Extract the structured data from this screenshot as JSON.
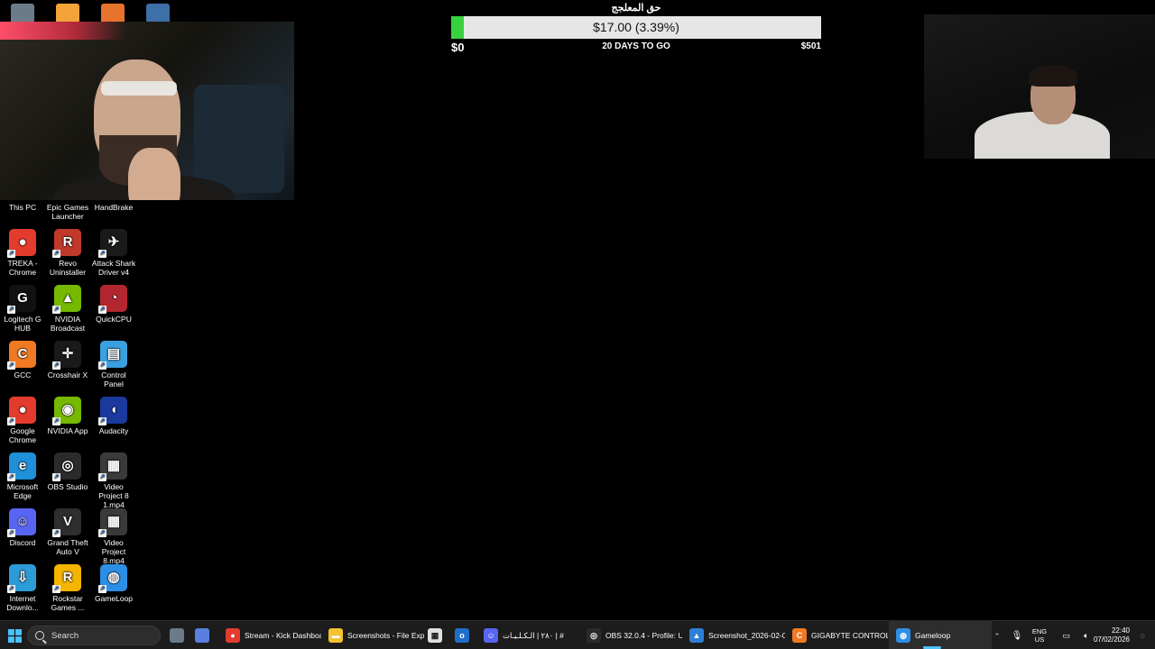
{
  "goal": {
    "title": "حق المعلجج",
    "amount_label": "$17.00 (3.39%)",
    "progress_percent": 3.39,
    "min_label": "$0",
    "days_label": "20 DAYS TO GO",
    "max_label": "$501",
    "fill_color": "#39d23f"
  },
  "desktop_icons": [
    {
      "label": "This PC",
      "icon": "this-pc-icon",
      "color": "#3d8ee8",
      "glyph": ""
    },
    {
      "label": "Epic Games Launcher",
      "icon": "epic-games-icon",
      "color": "#2a2a2a",
      "glyph": "E"
    },
    {
      "label": "HandBrake",
      "icon": "handbrake-icon",
      "color": "#e8732c",
      "glyph": "H"
    },
    {
      "label": "TREKA - Chrome",
      "icon": "chrome-icon",
      "color": "#e33b2e",
      "glyph": "●"
    },
    {
      "label": "Revo Uninstaller",
      "icon": "revo-uninstaller-icon",
      "color": "#c0392b",
      "glyph": "R"
    },
    {
      "label": "Attack Shark Driver v4",
      "icon": "attack-shark-icon",
      "color": "#1a1a1a",
      "glyph": "✈"
    },
    {
      "label": "Logitech G HUB",
      "icon": "logitech-ghub-icon",
      "color": "#111111",
      "glyph": "G"
    },
    {
      "label": "NVIDIA Broadcast",
      "icon": "nvidia-broadcast-icon",
      "color": "#76b900",
      "glyph": "▲"
    },
    {
      "label": "QuickCPU",
      "icon": "quickcpu-icon",
      "color": "#b3262f",
      "glyph": "◔"
    },
    {
      "label": "GCC",
      "icon": "gcc-icon",
      "color": "#f07a24",
      "glyph": "C"
    },
    {
      "label": "Crosshair X",
      "icon": "crosshair-icon",
      "color": "#1a1a1a",
      "glyph": "✛"
    },
    {
      "label": "Control Panel",
      "icon": "control-panel-icon",
      "color": "#3aa0e0",
      "glyph": "▤"
    },
    {
      "label": "Google Chrome",
      "icon": "chrome-icon",
      "color": "#e33b2e",
      "glyph": "●"
    },
    {
      "label": "NVIDIA App",
      "icon": "nvidia-app-icon",
      "color": "#76b900",
      "glyph": "◉"
    },
    {
      "label": "Audacity",
      "icon": "audacity-icon",
      "color": "#1b3a9e",
      "glyph": "◖"
    },
    {
      "label": "Microsoft Edge",
      "icon": "edge-icon",
      "color": "#1f8fd8",
      "glyph": "e"
    },
    {
      "label": "OBS Studio",
      "icon": "obs-icon",
      "color": "#2b2b2b",
      "glyph": "◎"
    },
    {
      "label": "Video Project 8 1.mp4",
      "icon": "video-file-icon",
      "color": "#3a3a3a",
      "glyph": "▦"
    },
    {
      "label": "Discord",
      "icon": "discord-icon",
      "color": "#5865f2",
      "glyph": "☺"
    },
    {
      "label": "Grand Theft Auto V",
      "icon": "gta-icon",
      "color": "#2e2e2e",
      "glyph": "V"
    },
    {
      "label": "Video Project 8.mp4",
      "icon": "video-file-icon",
      "color": "#3a3a3a",
      "glyph": "▦"
    },
    {
      "label": "Internet Downlo...",
      "icon": "idm-icon",
      "color": "#2d9bd6",
      "glyph": "⇩"
    },
    {
      "label": "Rockstar Games ...",
      "icon": "rockstar-icon",
      "color": "#f5b400",
      "glyph": "R"
    },
    {
      "label": "GameLoop",
      "icon": "gameloop-icon",
      "color": "#2c8fe6",
      "glyph": "◍"
    }
  ],
  "taskbar": {
    "search_label": "Search",
    "apps": [
      {
        "label": "Stream - Kick Dashboa",
        "icon": "chrome-icon",
        "color": "#e33b2e",
        "glyph": "●"
      },
      {
        "label": "Screenshots - File Expl",
        "icon": "folder-icon",
        "color": "#f2c230",
        "glyph": "▬"
      },
      {
        "label": "٢٨٠ | الـكـلـيـات | #",
        "icon": "discord-icon",
        "color": "#5865f2",
        "glyph": "☺"
      },
      {
        "label": "OBS 32.0.4 - Profile: U",
        "icon": "obs-icon",
        "color": "#2b2b2b",
        "glyph": "◎"
      },
      {
        "label": "Screenshot_2026-02-0",
        "icon": "photos-icon",
        "color": "#2d7fd6",
        "glyph": "▲"
      },
      {
        "label": "GIGABYTE CONTROL C",
        "icon": "gigabyte-icon",
        "color": "#f07a24",
        "glyph": "C"
      },
      {
        "label": "Gameloop",
        "icon": "gameloop-icon",
        "color": "#2c8fe6",
        "glyph": "◍"
      }
    ],
    "lang_top": "ENG",
    "lang_bottom": "US",
    "time": "22:40",
    "date": "07/02/2026"
  }
}
